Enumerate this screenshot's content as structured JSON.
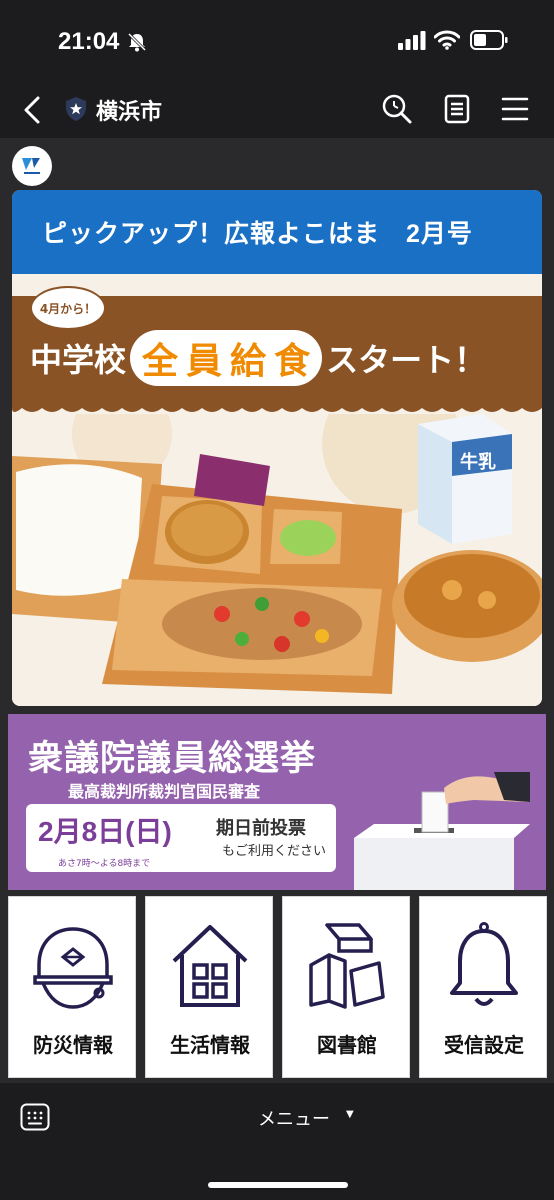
{
  "status_bar": {
    "time": "21:04"
  },
  "navbar": {
    "title": "横浜市"
  },
  "card": {
    "header": "ピックアップ！広報よこはま　2月号",
    "badge": "4月から！",
    "headline_pre": "中学校",
    "headline_chars": [
      "全",
      "員",
      "給",
      "食"
    ],
    "headline_post": "スタート！",
    "milk_label": "牛乳"
  },
  "election": {
    "title": "衆議院議員総選挙",
    "subtitle": "最高裁判所裁判官国民審査",
    "date": "2月8日(日)",
    "hours": "あさ7時～よる8時まで",
    "early_vote": "期日前投票",
    "early_vote_note": "もご利用ください"
  },
  "menu_tiles": [
    {
      "label": "防災情報",
      "icon": "helmet-icon"
    },
    {
      "label": "生活情報",
      "icon": "house-icon"
    },
    {
      "label": "図書館",
      "icon": "books-icon"
    },
    {
      "label": "受信設定",
      "icon": "bell-icon"
    }
  ],
  "bottom_bar": {
    "menu_label": "メニュー"
  },
  "colors": {
    "header_blue": "#1a70c4",
    "banner_brown": "#8a5326",
    "accent_orange": "#f08a00",
    "election_purple": "#9563ad",
    "icon_navy": "#241f4f"
  }
}
